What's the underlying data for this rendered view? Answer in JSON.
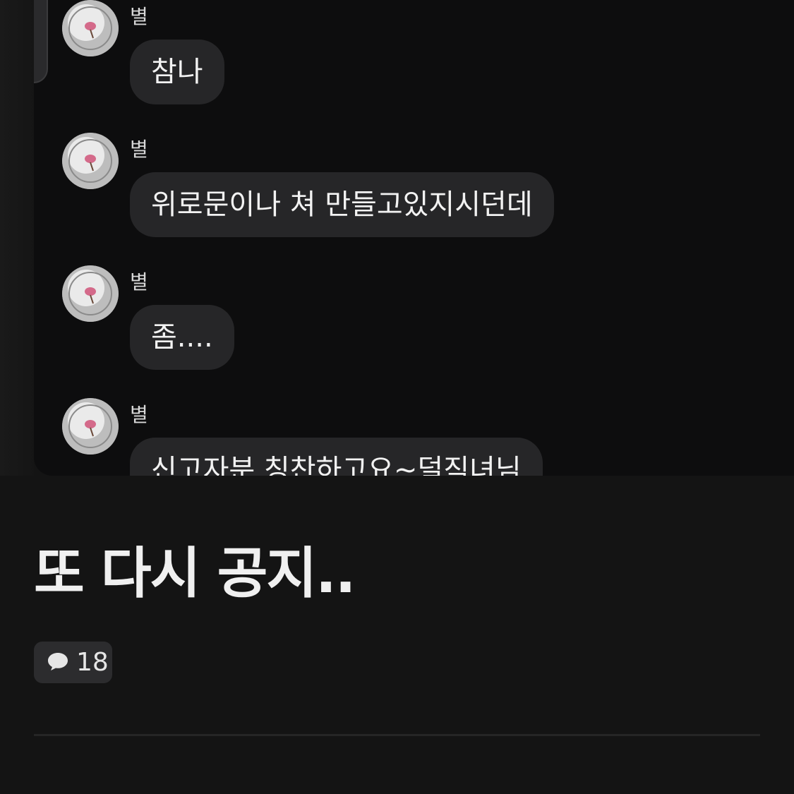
{
  "chat": {
    "messages": [
      {
        "sender": "별",
        "text": "참나"
      },
      {
        "sender": "별",
        "text": "위로문이나 쳐 만들고있지시던데"
      },
      {
        "sender": "별",
        "text": "좀...."
      },
      {
        "sender": "별",
        "text": "신고자분 칭찬하고요~덜직녀님"
      }
    ]
  },
  "post": {
    "title": "또 다시 공지..",
    "comment_count": "18"
  },
  "icons": {
    "comment": "speech-bubble-icon",
    "avatar": "profile-avatar"
  }
}
